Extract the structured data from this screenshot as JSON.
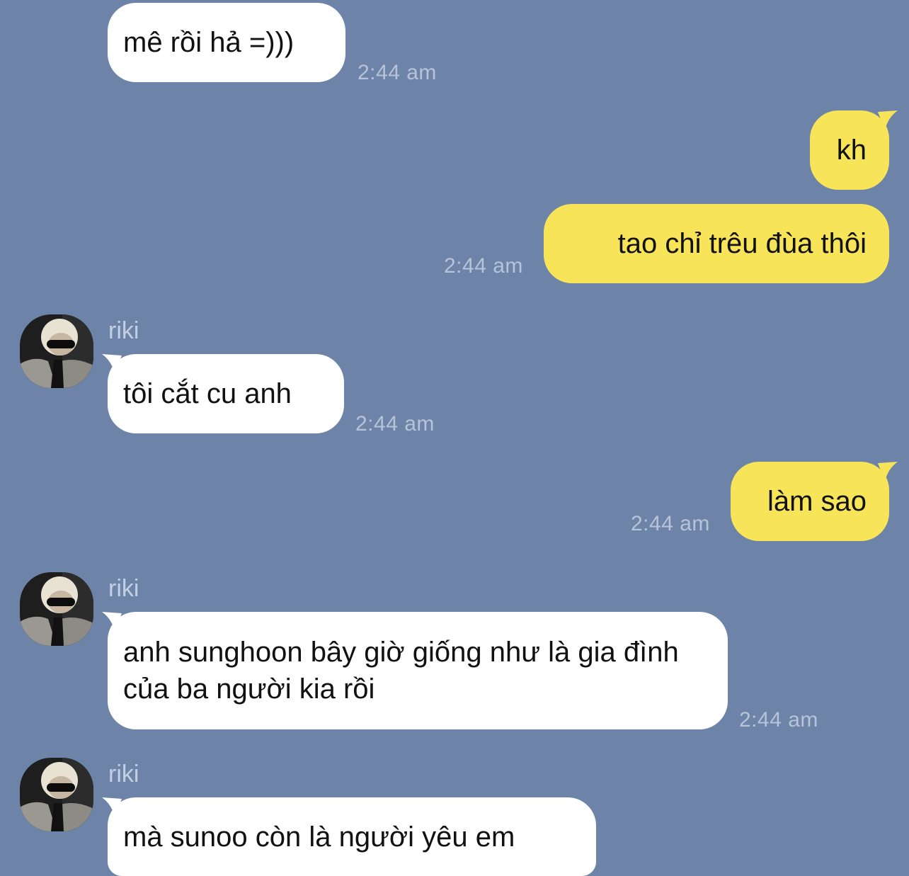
{
  "conversation": {
    "messages": [
      {
        "direction": "incoming",
        "text": "mê rồi hả =)))",
        "time": "2:44 am"
      },
      {
        "direction": "outgoing",
        "text": "kh",
        "time": ""
      },
      {
        "direction": "outgoing",
        "text": "tao chỉ trêu đùa thôi",
        "time": "2:44 am"
      },
      {
        "direction": "incoming",
        "sender": "riki",
        "text": "tôi cắt cu anh",
        "time": "2:44 am"
      },
      {
        "direction": "outgoing",
        "text": "làm sao",
        "time": "2:44 am"
      },
      {
        "direction": "incoming",
        "sender": "riki",
        "text": "anh sunghoon bây giờ giống như là gia đình của ba người kia rồi",
        "time": "2:44 am"
      },
      {
        "direction": "incoming",
        "sender": "riki",
        "text": "mà sunoo còn là người yêu em",
        "time": ""
      }
    ]
  },
  "colors": {
    "background": "#6d84a8",
    "incoming_bubble": "#ffffff",
    "outgoing_bubble": "#f7e458",
    "timestamp": "#b6c3d8"
  },
  "icons": {
    "avatar": "profile-photo-avatar"
  }
}
